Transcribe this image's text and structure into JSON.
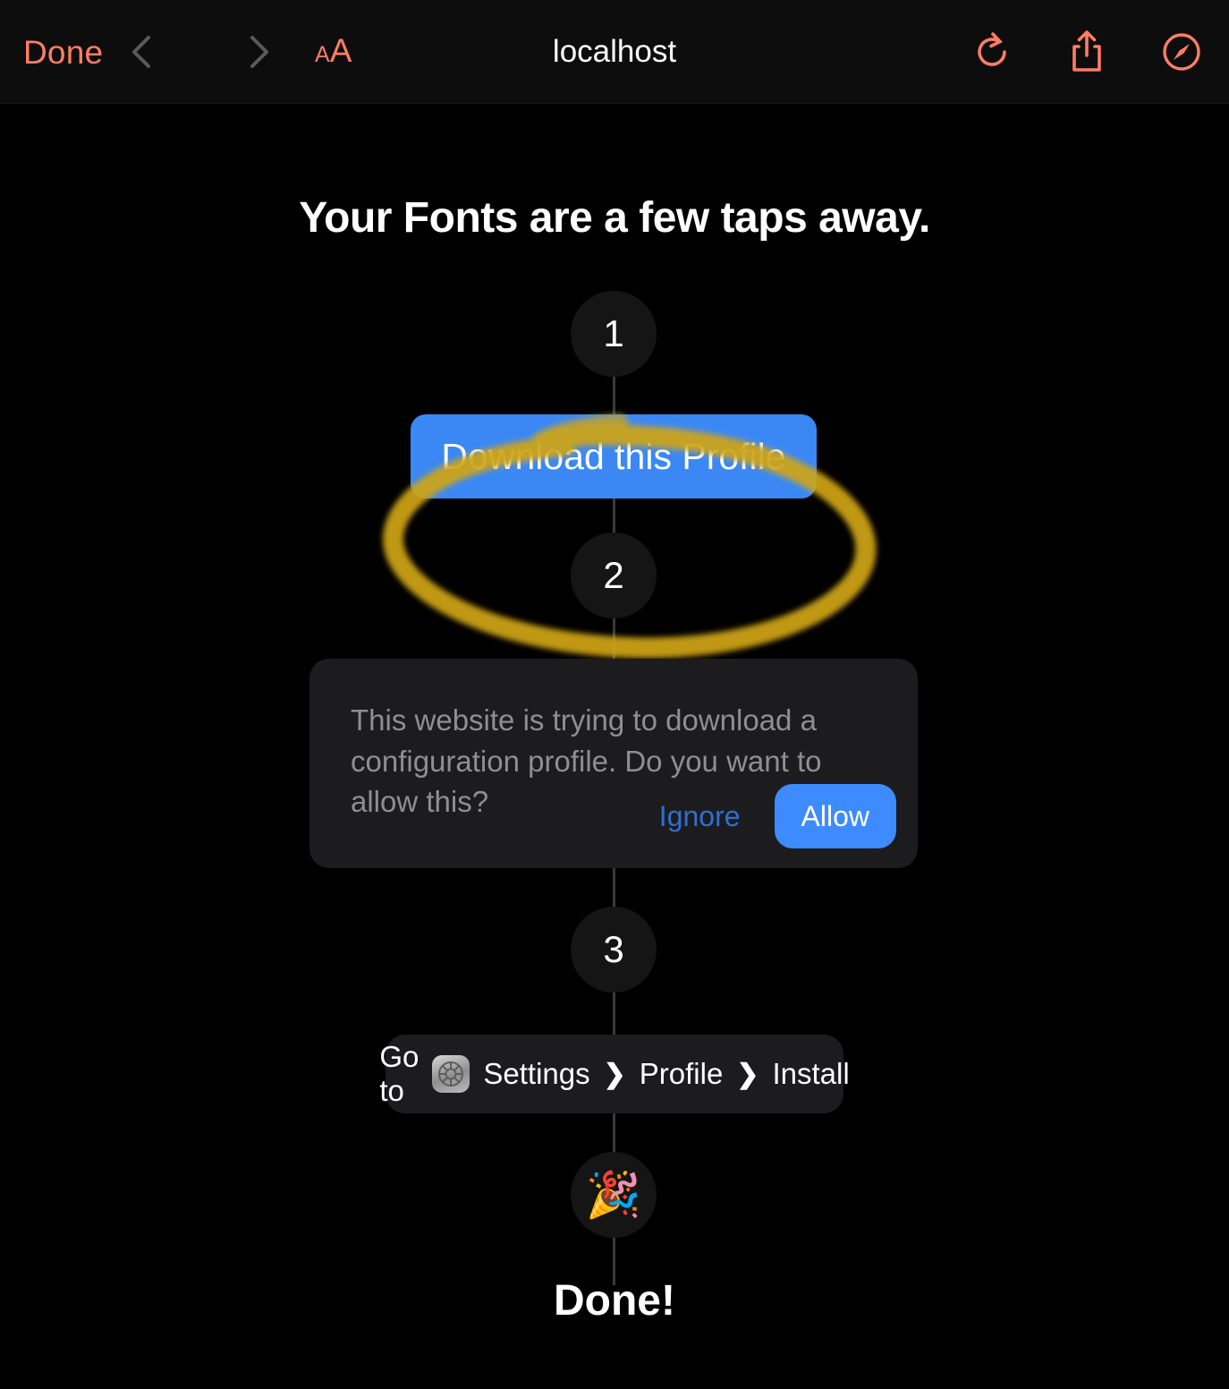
{
  "browser": {
    "done_label": "Done",
    "title": "localhost",
    "text_size_small": "A",
    "text_size_big": "A",
    "back_icon": "chevron-left-icon",
    "forward_icon": "chevron-right-icon",
    "reload_icon": "reload-icon",
    "share_icon": "share-icon",
    "safari_icon": "safari-compass-icon",
    "accent_color": "#ff7d65"
  },
  "page": {
    "headline": "Your Fonts are a few taps away.",
    "steps": [
      {
        "number": "1"
      },
      {
        "number": "2"
      },
      {
        "number": "3"
      }
    ],
    "download_button": {
      "label": "Download this Profile",
      "color": "#3b88f5"
    },
    "annotation": {
      "type": "hand-drawn-ellipse-highlight",
      "color": "#cfa414"
    },
    "dialog": {
      "message": "This website is trying to download a configuration profile. Do you want to allow this?",
      "ignore_label": "Ignore",
      "allow_label": "Allow",
      "ignore_color": "#2f6fd0",
      "allow_color": "#3e8bff"
    },
    "path": {
      "prefix": "Go to",
      "settings_icon": "settings-gear-icon",
      "crumbs": [
        "Settings",
        "Profile",
        "Install"
      ],
      "separator": "❯"
    },
    "celebration": {
      "emoji": "🎉",
      "label": "Done!"
    }
  }
}
